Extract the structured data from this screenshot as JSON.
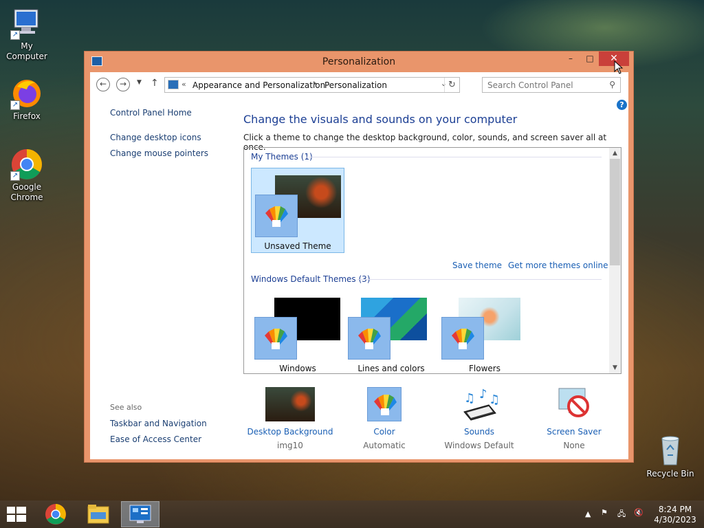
{
  "desktop": {
    "icons": [
      {
        "label": "My Computer",
        "icon": "computer-icon"
      },
      {
        "label": "Firefox",
        "icon": "firefox-icon"
      },
      {
        "label": "Google Chrome",
        "icon": "chrome-icon"
      },
      {
        "label": "Recycle Bin",
        "icon": "recycle-bin-icon"
      }
    ]
  },
  "window": {
    "title": "Personalization",
    "controls": {
      "minimize": "–",
      "maximize": "□",
      "close": "✕"
    },
    "address": {
      "chevron": "«",
      "crumbs": [
        "Appearance and Personalization",
        "Personalization"
      ],
      "separator": "▸"
    },
    "search": {
      "placeholder": "Search Control Panel"
    },
    "left_pane": {
      "home": "Control Panel Home",
      "links": [
        "Change desktop icons",
        "Change mouse pointers"
      ],
      "see_also_label": "See also",
      "see_also": [
        "Taskbar and Navigation",
        "Ease of Access Center"
      ]
    },
    "main": {
      "heading": "Change the visuals and sounds on your computer",
      "subheading": "Click a theme to change the desktop background, color, sounds, and screen saver all at once.",
      "my_themes_header": "My Themes (1)",
      "my_themes": [
        {
          "label": "Unsaved Theme",
          "selected": true
        }
      ],
      "save_theme": "Save theme",
      "get_more": "Get more themes online",
      "default_header": "Windows Default Themes (3)",
      "default_themes": [
        {
          "label": "Windows"
        },
        {
          "label": "Lines and colors"
        },
        {
          "label": "Flowers"
        }
      ]
    },
    "bottom": [
      {
        "label": "Desktop Background",
        "value": "img10",
        "icon": "desktop-background-icon"
      },
      {
        "label": "Color",
        "value": "Automatic",
        "icon": "color-icon"
      },
      {
        "label": "Sounds",
        "value": "Windows Default",
        "icon": "sounds-icon"
      },
      {
        "label": "Screen Saver",
        "value": "None",
        "icon": "screen-saver-icon"
      }
    ]
  },
  "taskbar": {
    "apps": [
      "chrome-icon",
      "file-explorer-icon",
      "control-panel-icon"
    ],
    "clock_time": "8:24 PM",
    "clock_date": "4/30/2023"
  },
  "colors": {
    "titlebar": "#e9956b",
    "link": "#1a5fb4",
    "heading": "#1c3f94",
    "selected": "#cce8ff",
    "close": "#c9403a"
  }
}
